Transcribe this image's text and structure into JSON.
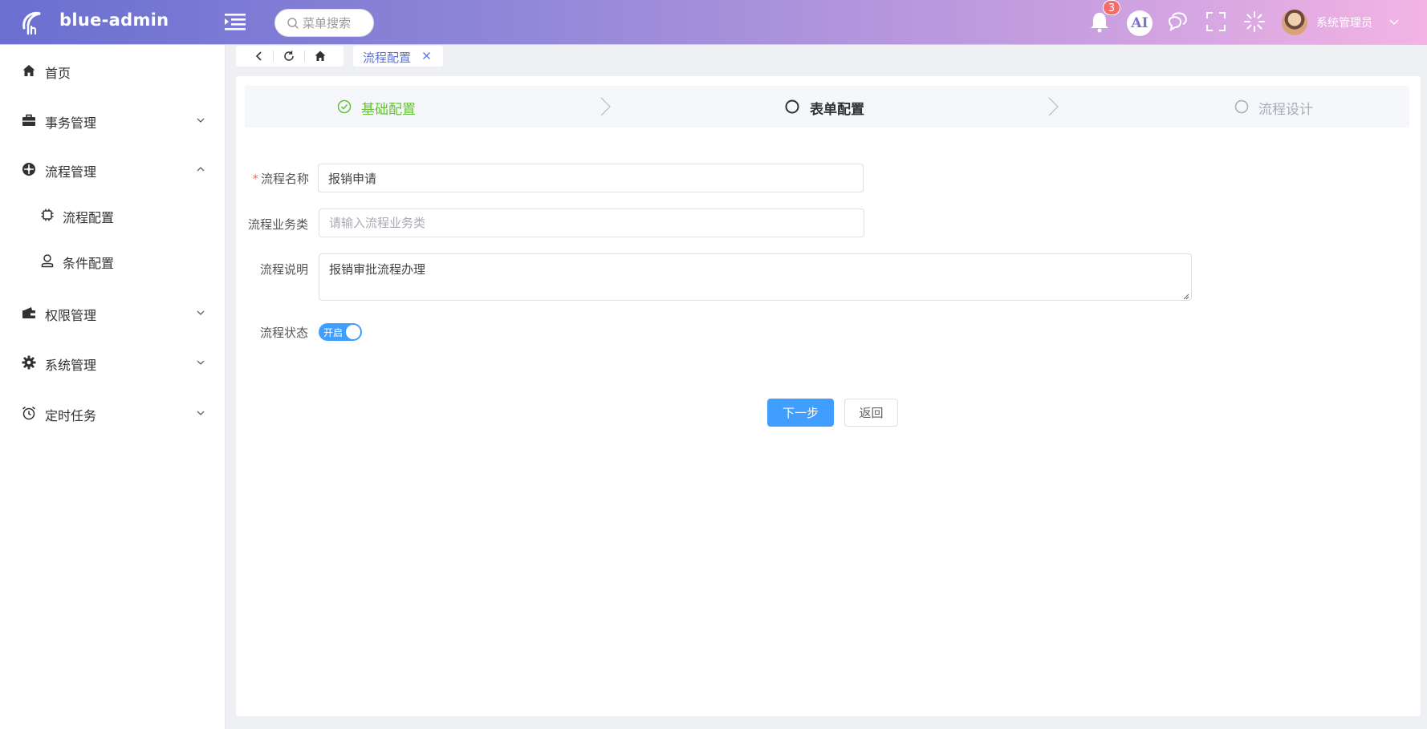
{
  "header": {
    "app_name": "blue-admin",
    "search_placeholder": "菜单搜索",
    "notification_count": "3",
    "ai_label": "AI",
    "username": "系统管理员"
  },
  "sidebar": {
    "items": [
      {
        "label": "首页",
        "icon": "home-icon"
      },
      {
        "label": "事务管理",
        "icon": "briefcase-icon"
      },
      {
        "label": "流程管理",
        "icon": "process-icon",
        "expanded": true
      },
      {
        "label": "流程配置",
        "icon": "chip-icon",
        "sub": true,
        "active": true
      },
      {
        "label": "条件配置",
        "icon": "user-icon",
        "sub": true
      },
      {
        "label": "权限管理",
        "icon": "wallet-icon"
      },
      {
        "label": "系统管理",
        "icon": "gear-icon"
      },
      {
        "label": "定时任务",
        "icon": "alarm-clock-icon"
      }
    ]
  },
  "tabs": {
    "active_tab": "流程配置"
  },
  "steps": [
    {
      "label": "基础配置",
      "status": "finished"
    },
    {
      "label": "表单配置",
      "status": "process"
    },
    {
      "label": "流程设计",
      "status": "wait"
    }
  ],
  "form": {
    "name_label": "流程名称",
    "name_value": "报销申请",
    "category_label": "流程业务类",
    "category_placeholder": "请输入流程业务类",
    "desc_label": "流程说明",
    "desc_value": "报销审批流程办理",
    "status_label": "流程状态",
    "status_switch_text": "开启",
    "status_on": true
  },
  "buttons": {
    "next": "下一步",
    "back": "返回"
  },
  "colors": {
    "primary": "#409eff",
    "success": "#67c23a",
    "header_gradient_start": "#6a6fd0",
    "header_gradient_end": "#f3b4e4"
  }
}
